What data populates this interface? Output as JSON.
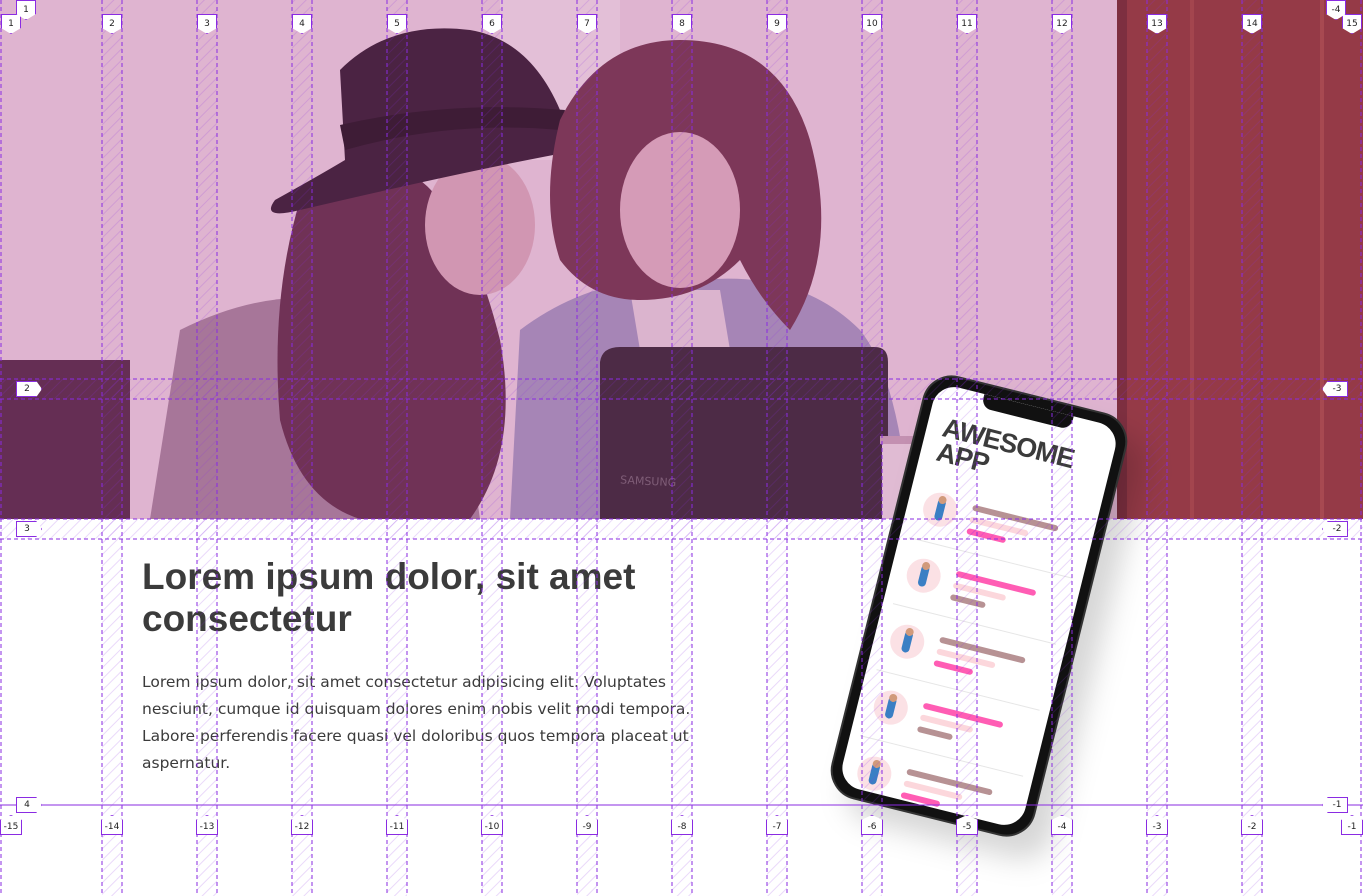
{
  "hero": {
    "laptop_brand": "SAMSUNG"
  },
  "content": {
    "headline": "Lorem ipsum dolor, sit amet consectetur",
    "body": "Lorem ipsum dolor, sit amet consectetur adipisicing elit. Voluptates nesciunt, cumque id quisquam dolores enim nobis velit modi tempora. Labore perferendis facere quasi vel doloribus quos tempora placeat ut aspernatur."
  },
  "phone": {
    "app_title": "AWESOME APP",
    "rows": 5
  },
  "grid_overlay": {
    "color": "#8a2be2",
    "column_labels_top": [
      "1",
      "2",
      "3",
      "4",
      "5",
      "6",
      "7",
      "8",
      "9",
      "10",
      "11",
      "12",
      "13",
      "14",
      "15"
    ],
    "column_labels_top_right": "-4",
    "column_labels_bottom": [
      "-15",
      "-14",
      "-13",
      "-12",
      "-11",
      "-10",
      "-9",
      "-8",
      "-7",
      "-6",
      "-5",
      "-4",
      "-3",
      "-2",
      "-1"
    ],
    "row_labels_left": [
      "1",
      "2",
      "3",
      "4"
    ],
    "row_labels_right": [
      "-3",
      "-2",
      "-1"
    ]
  },
  "colors": {
    "hero_tint": "#c06aa6",
    "text": "#3b3b3b",
    "accent_pink": "#ff5db4",
    "muted_mauve": "#b79294",
    "light_pink": "#fcd7dc"
  }
}
